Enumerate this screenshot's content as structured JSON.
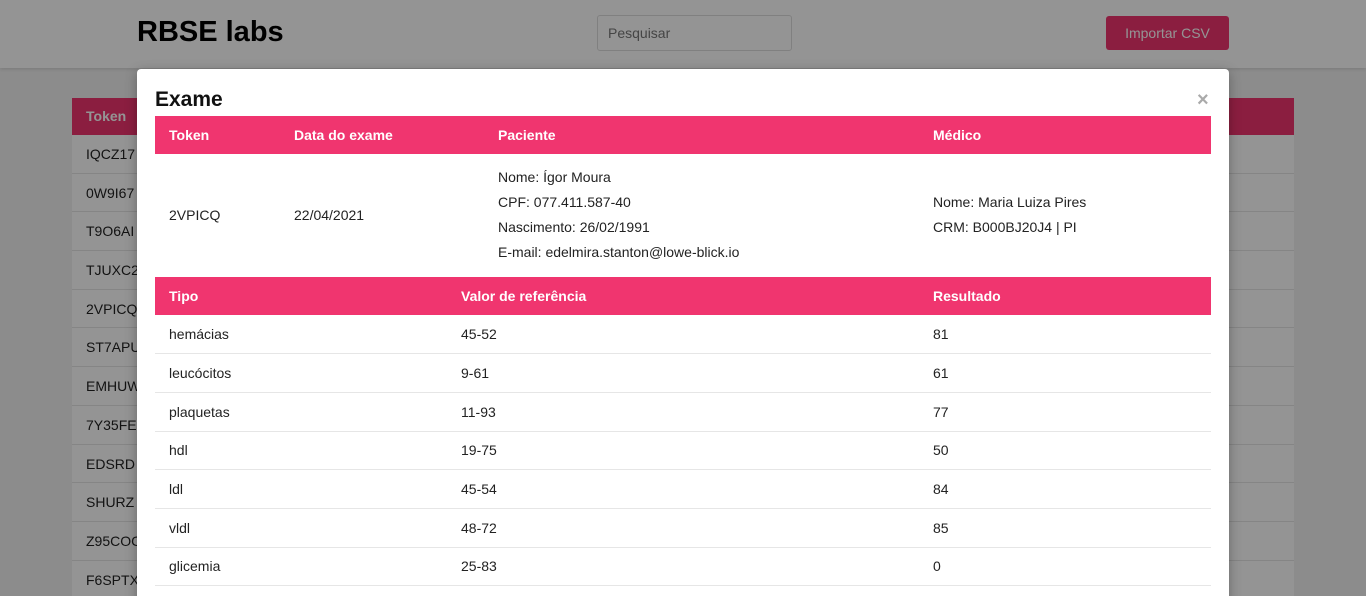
{
  "header": {
    "brand": "RBSE labs",
    "search_placeholder": "Pesquisar",
    "import_label": "Importar CSV"
  },
  "background_table": {
    "header": "Token",
    "rows": [
      "IQCZ17",
      "0W9I67",
      "T9O6AI",
      "TJUXC2",
      "2VPICQ",
      "ST7APU",
      "EMHUW",
      "7Y35FE",
      "EDSRD",
      "SHURZ",
      "Z95COC",
      "F6SPTX"
    ]
  },
  "modal": {
    "title": "Exame",
    "close": "×",
    "exam_headers": {
      "token": "Token",
      "date": "Data do exame",
      "patient": "Paciente",
      "doctor": "Médico"
    },
    "exam": {
      "token": "2VPICQ",
      "date": "22/04/2021",
      "patient": {
        "name": "Nome: Ígor Moura",
        "cpf": "CPF: 077.411.587-40",
        "birth": "Nascimento: 26/02/1991",
        "email": "E-mail: edelmira.stanton@lowe-blick.io"
      },
      "doctor": {
        "name": "Nome: Maria Luiza Pires",
        "crm": "CRM: B000BJ20J4 | PI"
      }
    },
    "results_headers": {
      "type": "Tipo",
      "reference": "Valor de referência",
      "result": "Resultado"
    },
    "results": [
      {
        "type": "hemácias",
        "reference": "45-52",
        "result": "81",
        "status": "high"
      },
      {
        "type": "leucócitos",
        "reference": "9-61",
        "result": "61",
        "status": "ok"
      },
      {
        "type": "plaquetas",
        "reference": "11-93",
        "result": "77",
        "status": "ok"
      },
      {
        "type": "hdl",
        "reference": "19-75",
        "result": "50",
        "status": "ok"
      },
      {
        "type": "ldl",
        "reference": "45-54",
        "result": "84",
        "status": "high"
      },
      {
        "type": "vldl",
        "reference": "48-72",
        "result": "85",
        "status": "high"
      },
      {
        "type": "glicemia",
        "reference": "25-83",
        "result": "0",
        "status": "high"
      }
    ]
  },
  "colors": {
    "accent": "#f0356f",
    "result_out_of_range": "#e8232c",
    "result_in_range": "#1a8a1a"
  }
}
